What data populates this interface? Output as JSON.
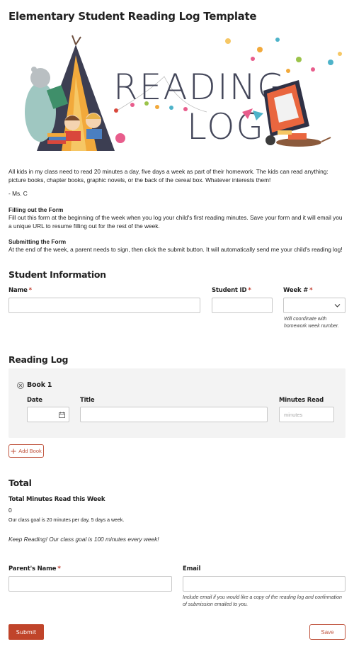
{
  "page": {
    "title": "Elementary Student Reading Log Template",
    "hero_word_1": "READING",
    "hero_word_2": "LOG"
  },
  "intro": {
    "paragraph": "All kids in my class need to read 20 minutes a day, five days a week as part of their homework. The kids can read anything: picture books, chapter books, graphic novels, or the back of the cereal box. Whatever interests them!",
    "signature": "- Ms. C",
    "filling_heading": "Filling out the Form",
    "filling_text": "Fill out this form at the beginning of the week when you log your child's first reading minutes. Save your form and it will email you a unique URL to resume filling out for the rest of the week.",
    "submitting_heading": "Submitting the Form",
    "submitting_text": "At the end of the week, a parent needs to sign, then click the submit button. It will automatically send me your child's reading log!"
  },
  "student_info": {
    "heading": "Student Information",
    "name_label": "Name",
    "student_id_label": "Student ID",
    "week_label": "Week #",
    "required_mark": "*",
    "week_hint": "Will coordinate with homework week number."
  },
  "reading_log": {
    "heading": "Reading Log",
    "book_title": "Book 1",
    "date_label": "Date",
    "title_label": "Title",
    "minutes_label": "Minutes Read",
    "minutes_placeholder": "minutes",
    "add_book_label": "Add Book"
  },
  "total": {
    "heading": "Total",
    "total_label": "Total Minutes Read this Week",
    "total_value": "0",
    "goal_note": "Our class goal is 20 minutes per day, 5 days a week.",
    "encourage": "Keep Reading! Our class goal is 100 minutes every week!"
  },
  "contact": {
    "parent_label": "Parent's Name",
    "email_label": "Email",
    "email_hint": "Include email if you would like a copy of the reading log and confirmation of submission emailed to you."
  },
  "actions": {
    "submit_label": "Submit",
    "save_label": "Save"
  },
  "colors": {
    "accent": "#c0442a",
    "required": "#c0392b",
    "panel_bg": "#f3f3f3"
  }
}
